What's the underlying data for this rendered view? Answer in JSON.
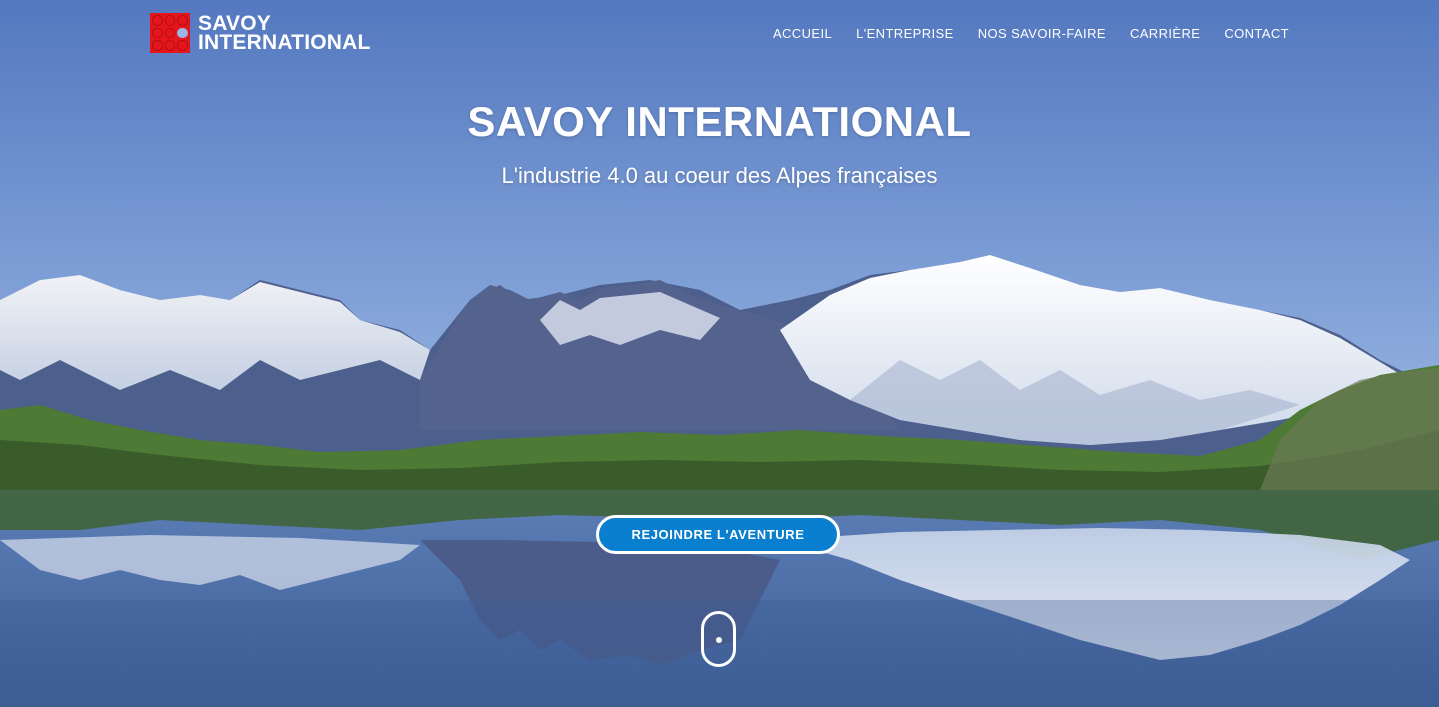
{
  "brand": {
    "line1": "SAVOY",
    "line2": "INTERNATIONAL",
    "color": "#e4161b"
  },
  "nav": {
    "items": [
      {
        "label": "ACCUEIL"
      },
      {
        "label": "L'ENTREPRISE"
      },
      {
        "label": "NOS SAVOIR-FAIRE"
      },
      {
        "label": "CARRIÈRE"
      },
      {
        "label": "CONTACT"
      }
    ]
  },
  "hero": {
    "title": "SAVOY INTERNATIONAL",
    "subtitle": "L'industrie 4.0 au coeur des Alpes françaises",
    "cta_label": "REJOINDRE L'AVENTURE",
    "cta_color": "#0a7fd0",
    "scroll_icon": "mouse-scroll-icon",
    "background": "mountain-lake-reflection-image"
  }
}
